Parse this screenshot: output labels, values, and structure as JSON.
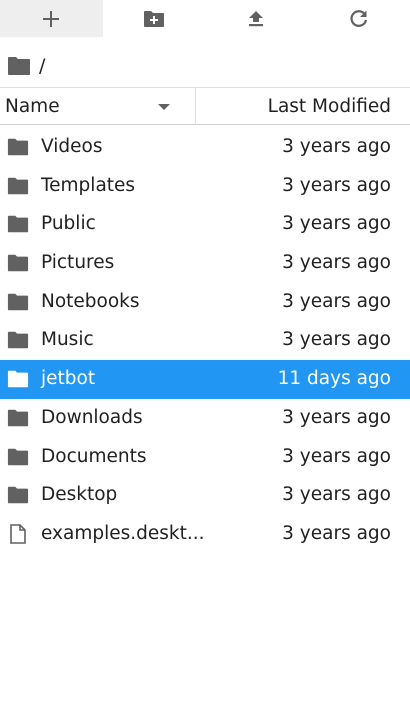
{
  "toolbar": {
    "buttons": [
      {
        "name": "new-launcher-button",
        "icon": "plus-icon"
      },
      {
        "name": "new-folder-button",
        "icon": "new-folder-icon"
      },
      {
        "name": "upload-button",
        "icon": "upload-icon"
      },
      {
        "name": "refresh-button",
        "icon": "refresh-icon"
      }
    ]
  },
  "breadcrumb": {
    "home_icon": "folder-icon",
    "separator": "/"
  },
  "header": {
    "name_label": "Name",
    "modified_label": "Last Modified",
    "sort_icon": "caret-down-icon"
  },
  "colors": {
    "selected_bg": "#2196f3",
    "selected_text": "#ffffff",
    "icon": "#616161"
  },
  "files": [
    {
      "name": "Videos",
      "modified": "3 years ago",
      "type": "folder"
    },
    {
      "name": "Templates",
      "modified": "3 years ago",
      "type": "folder"
    },
    {
      "name": "Public",
      "modified": "3 years ago",
      "type": "folder"
    },
    {
      "name": "Pictures",
      "modified": "3 years ago",
      "type": "folder"
    },
    {
      "name": "Notebooks",
      "modified": "3 years ago",
      "type": "folder"
    },
    {
      "name": "Music",
      "modified": "3 years ago",
      "type": "folder"
    },
    {
      "name": "jetbot",
      "modified": "11 days ago",
      "type": "folder",
      "selected": true
    },
    {
      "name": "Downloads",
      "modified": "3 years ago",
      "type": "folder"
    },
    {
      "name": "Documents",
      "modified": "3 years ago",
      "type": "folder"
    },
    {
      "name": "Desktop",
      "modified": "3 years ago",
      "type": "folder"
    },
    {
      "name": "examples.deskt...",
      "modified": "3 years ago",
      "type": "file"
    }
  ]
}
